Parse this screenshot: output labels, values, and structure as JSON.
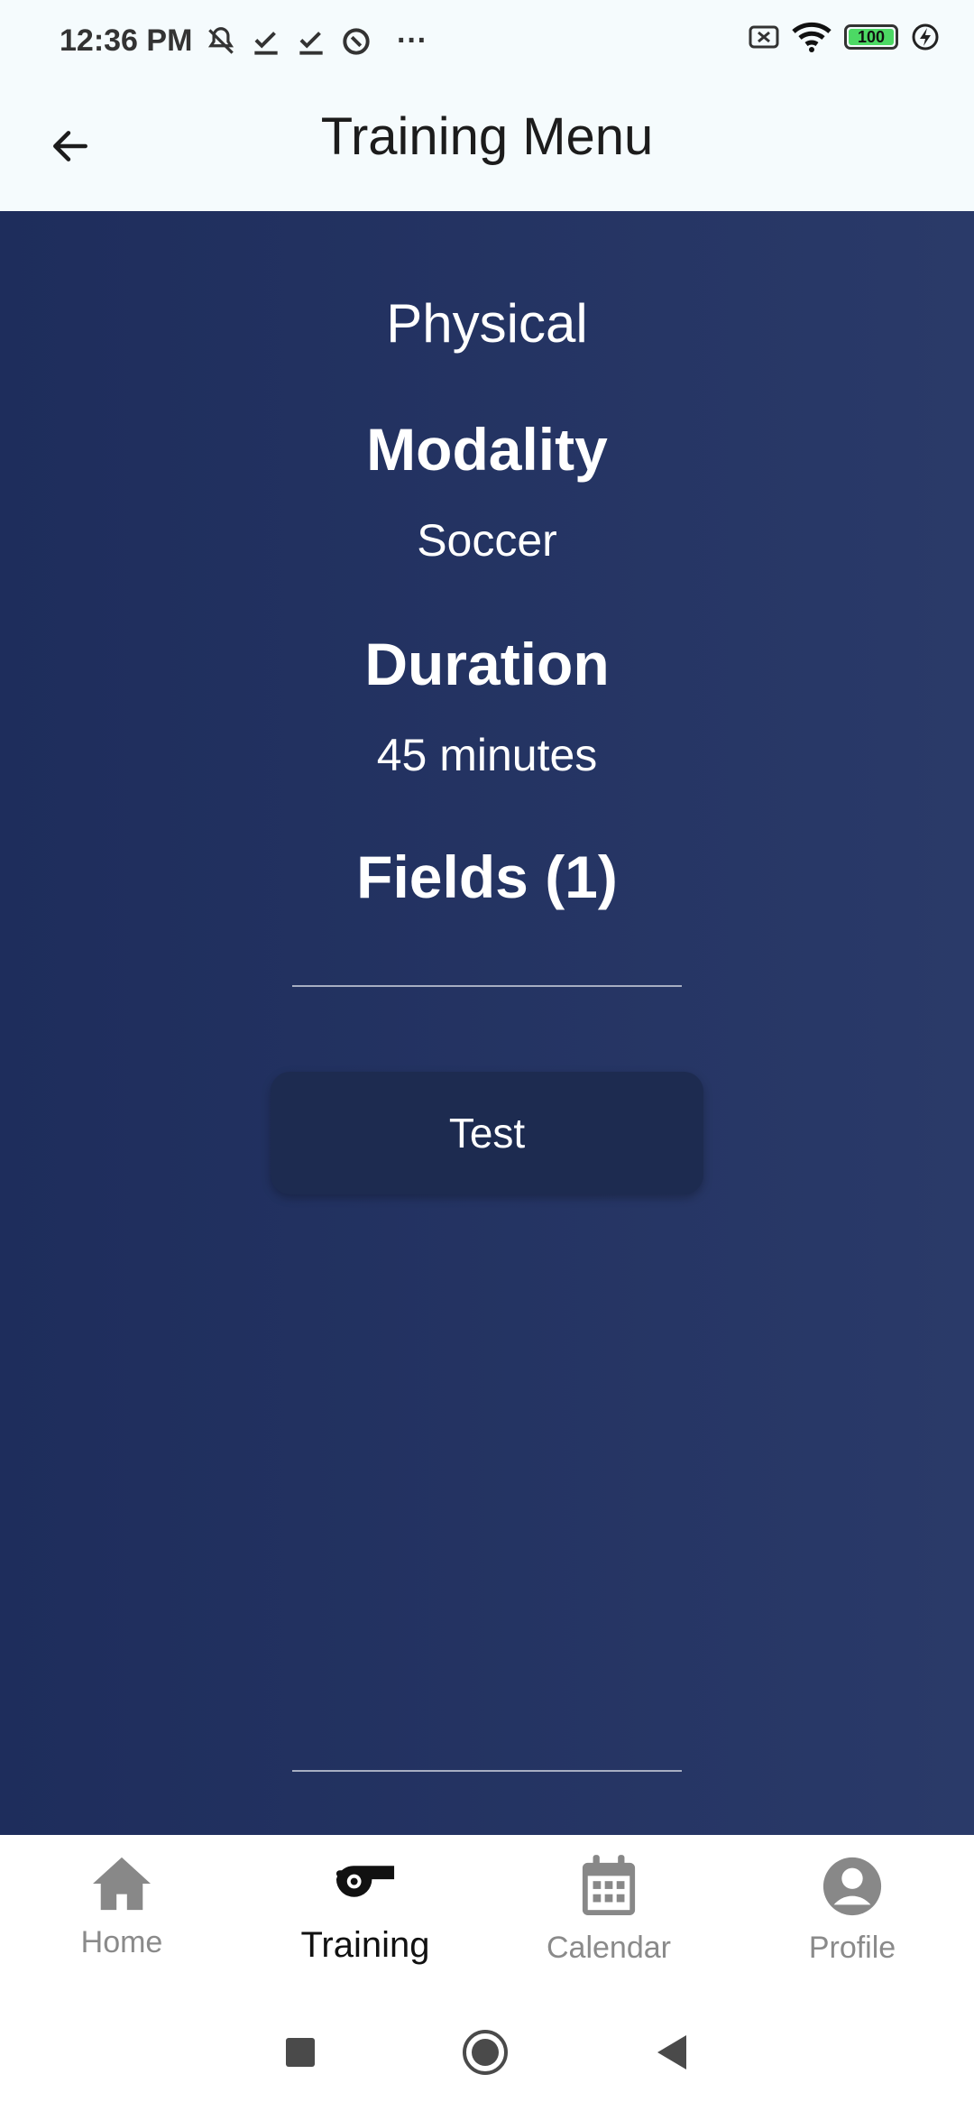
{
  "status_bar": {
    "time": "12:36 PM",
    "more": "···",
    "battery_level": "100"
  },
  "app_bar": {
    "title": "Training Menu",
    "back_icon": "arrow-left-icon"
  },
  "training": {
    "category": "Physical",
    "modality_label": "Modality",
    "modality_value": "Soccer",
    "duration_label": "Duration",
    "duration_value": "45 minutes",
    "fields_label": "Fields (1)",
    "fields": [
      {
        "label": "Test"
      }
    ]
  },
  "bottom_nav": {
    "items": [
      {
        "label": "Home",
        "icon": "home-icon",
        "active": false
      },
      {
        "label": "Training",
        "icon": "whistle-icon",
        "active": true
      },
      {
        "label": "Calendar",
        "icon": "calendar-icon",
        "active": false
      },
      {
        "label": "Profile",
        "icon": "profile-icon",
        "active": false
      }
    ]
  },
  "colors": {
    "content_bg_start": "#1e2d5c",
    "content_bg_end": "#2a3a69",
    "field_button_bg": "#1d2b50",
    "battery_green": "#4cd964"
  }
}
